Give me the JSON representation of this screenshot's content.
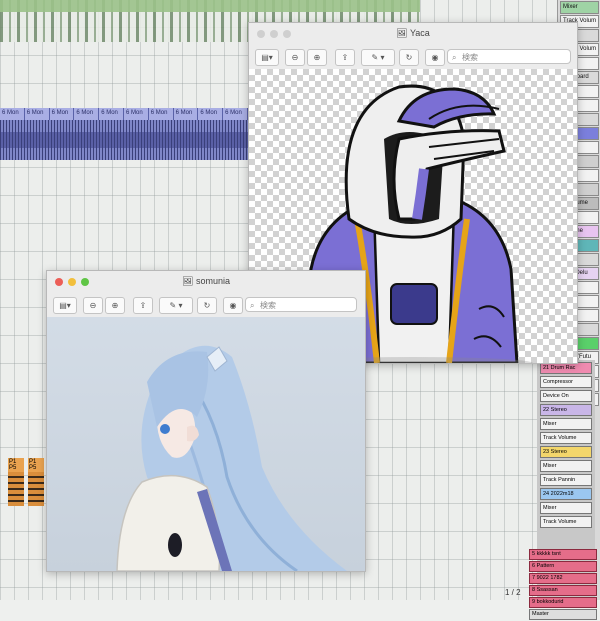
{
  "daw": {
    "clip_label": "6 Mon",
    "clip_count": 10,
    "markers": [
      "P1 P5",
      "P1 P5"
    ],
    "tracks": [
      {
        "label": "Mixer",
        "color": "#9fd3a5"
      },
      {
        "label": "Track Volum",
        "color": "#f2f2f2"
      },
      {
        "label": "Mixer",
        "color": "#d9d9d9"
      },
      {
        "label": "Track Volum",
        "color": "#f2f2f2"
      },
      {
        "label": "",
        "color": "#f2f2f2"
      },
      {
        "label": "Keyboard",
        "color": "#d9d9d9"
      },
      {
        "label": "",
        "color": "#f2f2f2"
      },
      {
        "label": "",
        "color": "#f2f2f2"
      },
      {
        "label": "Audio",
        "color": "#d9d9d9"
      },
      {
        "label": "Mon",
        "color": "#7b7fdc"
      },
      {
        "label": "",
        "color": "#f2f2f2"
      },
      {
        "label": "",
        "color": "#cfcfcf"
      },
      {
        "label": "",
        "color": "#f2f2f2"
      },
      {
        "label": "",
        "color": "#cfcfcf"
      },
      {
        "label": "o Volume",
        "color": "#bcbcbc"
      },
      {
        "label": "",
        "color": "#f2f2f2"
      },
      {
        "label": "Volume",
        "color": "#e8c4f0"
      },
      {
        "label": "",
        "color": "#5fb6b8"
      },
      {
        "label": "Mon",
        "color": "#d9d9d9"
      },
      {
        "label": "Dec Delu",
        "color": "#e6d3f2"
      },
      {
        "label": "sse",
        "color": "#f2f2f2"
      },
      {
        "label": "",
        "color": "#f2f2f2"
      },
      {
        "label": "",
        "color": "#f2f2f2"
      },
      {
        "label": "ding",
        "color": "#d9d9d9"
      },
      {
        "label": "Fade",
        "color": "#5ad06a"
      },
      {
        "label": "Clap (Futu",
        "color": "#f2f2f2"
      },
      {
        "label": "",
        "color": "#f2f2f2"
      },
      {
        "label": "",
        "color": "#f2f2f2"
      },
      {
        "label": "",
        "color": "#f2f2f2"
      }
    ],
    "devices": [
      {
        "head": "21 Drum Rac",
        "head_color": "#f08bb0",
        "rows": [
          "Compressor",
          "Device On"
        ]
      },
      {
        "head": "22 Stereo",
        "head_color": "#c9b6e8",
        "rows": [
          "Mixer",
          "Track Volume"
        ]
      },
      {
        "head": "23 Stereo",
        "head_color": "#f3d66b",
        "rows": [
          "Mixer",
          "Track Pannin"
        ]
      },
      {
        "head": "24 2022m18",
        "head_color": "#9bc7f0",
        "rows": [
          "Mixer",
          "Track Volume"
        ]
      }
    ],
    "bottom_list": [
      "5 kkkkk tsnt",
      "6 Pattern",
      "7 9022 1782",
      "8 Ssassan",
      "9 bokkodurid"
    ],
    "master_label": "Master",
    "pager": "1 / 2"
  },
  "windows": {
    "yaca": {
      "title": "Yaca",
      "search_placeholder": "検索"
    },
    "somunia": {
      "title": "somunia",
      "search_placeholder": "検索"
    }
  },
  "colors": {
    "clip": "#7f86c8",
    "jacket": "#7b6fd4",
    "hair": "#b3cbe8"
  }
}
